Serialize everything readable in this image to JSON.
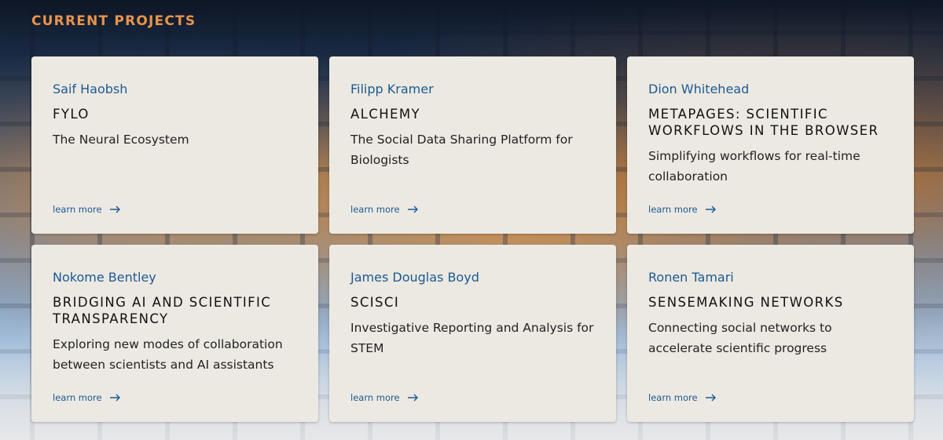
{
  "section": {
    "title": "CURRENT PROJECTS"
  },
  "projects": [
    {
      "author": "Saif Haobsh",
      "title": "FYLO",
      "description": "The Neural Ecosystem",
      "link": "learn more"
    },
    {
      "author": "Filipp Kramer",
      "title": "ALCHEMY",
      "description": "The Social Data Sharing Platform for Biologists",
      "link": "learn more"
    },
    {
      "author": "Dion Whitehead",
      "title": "METAPAGES: SCIENTIFIC WORKFLOWS IN THE BROWSER",
      "description": "Simplifying workflows for real-time collaboration",
      "link": "learn more"
    },
    {
      "author": "Nokome Bentley",
      "title": "BRIDGING AI AND SCIENTIFIC TRANSPARENCY",
      "description": "Exploring new modes of collaboration between scientists and AI assistants",
      "link": "learn more"
    },
    {
      "author": "James Douglas Boyd",
      "title": "SCISCI",
      "description": "Investigative Reporting and Analysis for STEM",
      "link": "learn more"
    },
    {
      "author": "Ronen Tamari",
      "title": "SENSEMAKING NETWORKS",
      "description": "Connecting social networks to accelerate scientific progress",
      "link": "learn more"
    }
  ],
  "icons": {
    "link_arrow": "arrow-right-icon"
  },
  "colors": {
    "accent": "#e8944a",
    "link": "#1c5a93",
    "card": "#ece9e2"
  }
}
